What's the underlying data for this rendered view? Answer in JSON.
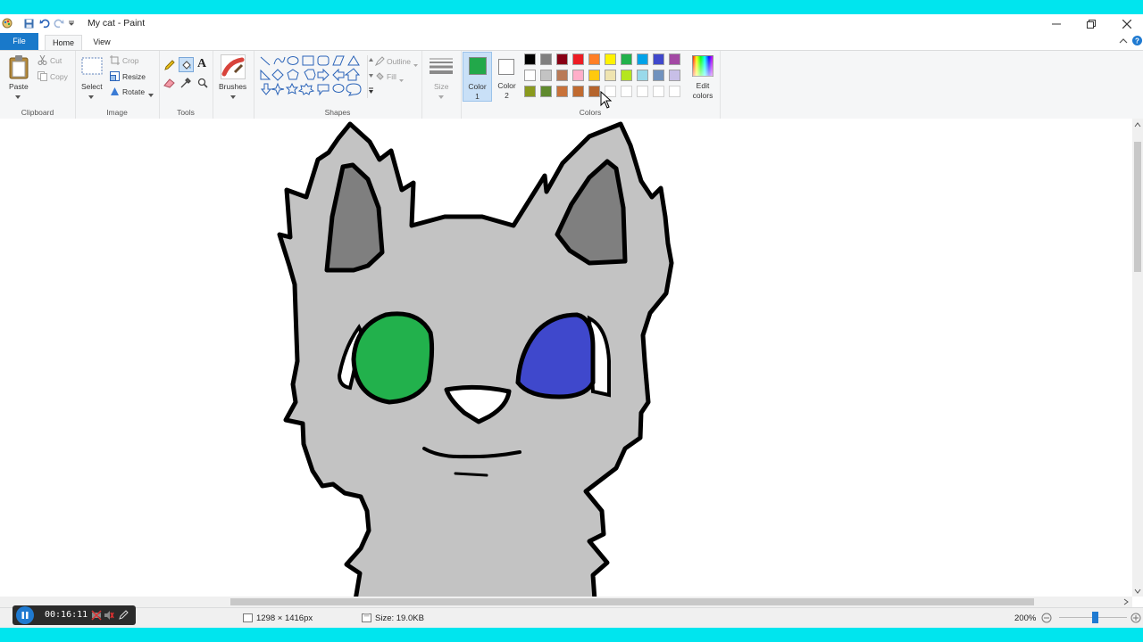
{
  "window": {
    "title": "My cat - Paint"
  },
  "tabs": {
    "file": "File",
    "home": "Home",
    "view": "View"
  },
  "clipboard": {
    "paste": "Paste",
    "cut": "Cut",
    "copy": "Copy",
    "label": "Clipboard"
  },
  "image": {
    "select": "Select",
    "crop": "Crop",
    "resize": "Resize",
    "rotate": "Rotate",
    "label": "Image"
  },
  "tools": {
    "label": "Tools",
    "brushes": "Brushes"
  },
  "shapes": {
    "label": "Shapes",
    "outline": "Outline",
    "fill": "Fill"
  },
  "size": {
    "label": "Size"
  },
  "colors": {
    "color1": "Color\n1",
    "color1_a": "Color",
    "color1_b": "1",
    "color2_a": "Color",
    "color2_b": "2",
    "edit_a": "Edit",
    "edit_b": "colors",
    "label": "Colors",
    "color1_value": "#22a84a",
    "color2_value": "#ffffff",
    "palette_row1": [
      "#000000",
      "#7f7f7f",
      "#880015",
      "#ed1c24",
      "#ff7f27",
      "#fff200",
      "#22b14c",
      "#00a2e8",
      "#3f48cc",
      "#a349a4"
    ],
    "palette_row2": [
      "#ffffff",
      "#c3c3c3",
      "#b97a57",
      "#ffaec9",
      "#ffc90e",
      "#efe4b0",
      "#b5e61d",
      "#99d9ea",
      "#7092be",
      "#c8bfe7"
    ],
    "palette_row3": [
      "#8a9a1e",
      "#5f8a2e",
      "#c8723a",
      "#c06a30",
      "#b5652e",
      "#ffffff",
      "#ffffff",
      "#ffffff",
      "#ffffff",
      "#ffffff"
    ]
  },
  "status": {
    "dimensions": "1298 × 1416px",
    "size": "Size: 19.0KB",
    "zoom": "200%"
  },
  "recorder": {
    "time": "00:16:11"
  }
}
